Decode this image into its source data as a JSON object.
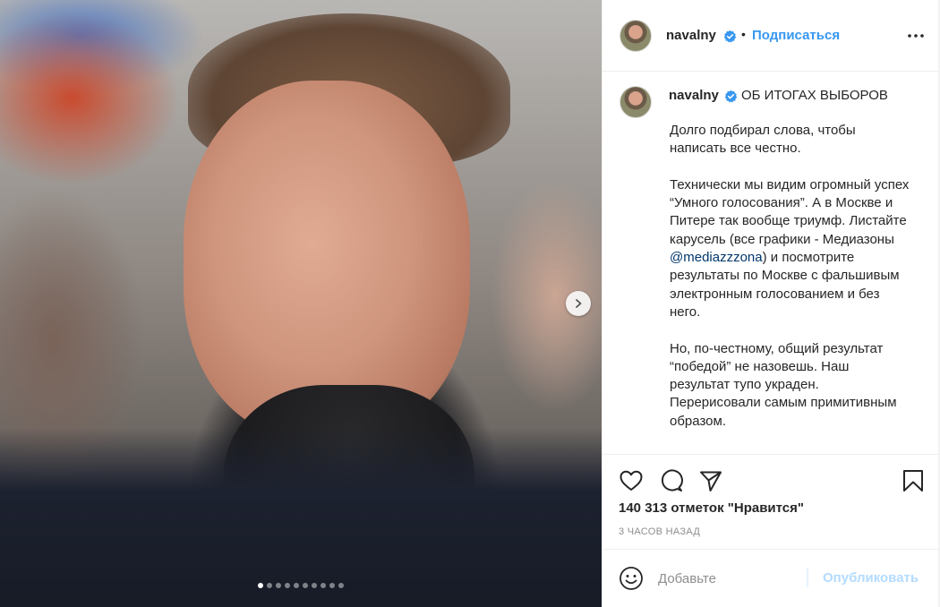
{
  "post": {
    "author": "navalny",
    "follow_label": "Подписаться",
    "separator": "•",
    "caption_title": "ОБ ИТОГАХ ВЫБОРОВ",
    "caption_paragraphs": [
      "Долго подбирал слова, чтобы написать все честно.",
      {
        "before": "Технически мы видим огромный успех “Умного голосования”. А в Москве и Питере так вообще триумф. Листайте карусель (все графики - Медиазоны ",
        "mention": "@mediazzzona",
        "after": ") и посмотрите результаты по Москве с фальшивым электронным голосованием и без него."
      },
      "Но, по-честному, общий результат “победой” не назовешь. Наш результат тупо украден. Перерисовали самым примитивным образом."
    ],
    "likes": "140 313 отметок \"Нравится\"",
    "time_ago": "3 ЧАСОВ НАЗАД"
  },
  "comment": {
    "placeholder": "Добавьте",
    "publish_label": "Опубликовать"
  },
  "carousel": {
    "slide_count": 10,
    "active_index": 0
  },
  "icons": {
    "verified": "verified-badge-icon",
    "more": "more-options-icon",
    "like": "heart-icon",
    "comment": "comment-bubble-icon",
    "share": "paper-plane-icon",
    "save": "bookmark-icon",
    "emoji": "smiley-icon",
    "next": "chevron-right-icon"
  },
  "colors": {
    "accent": "#3897f0",
    "verified": "#3897f0",
    "publish_disabled": "#b3dbff",
    "muted": "#8e8e8e"
  }
}
